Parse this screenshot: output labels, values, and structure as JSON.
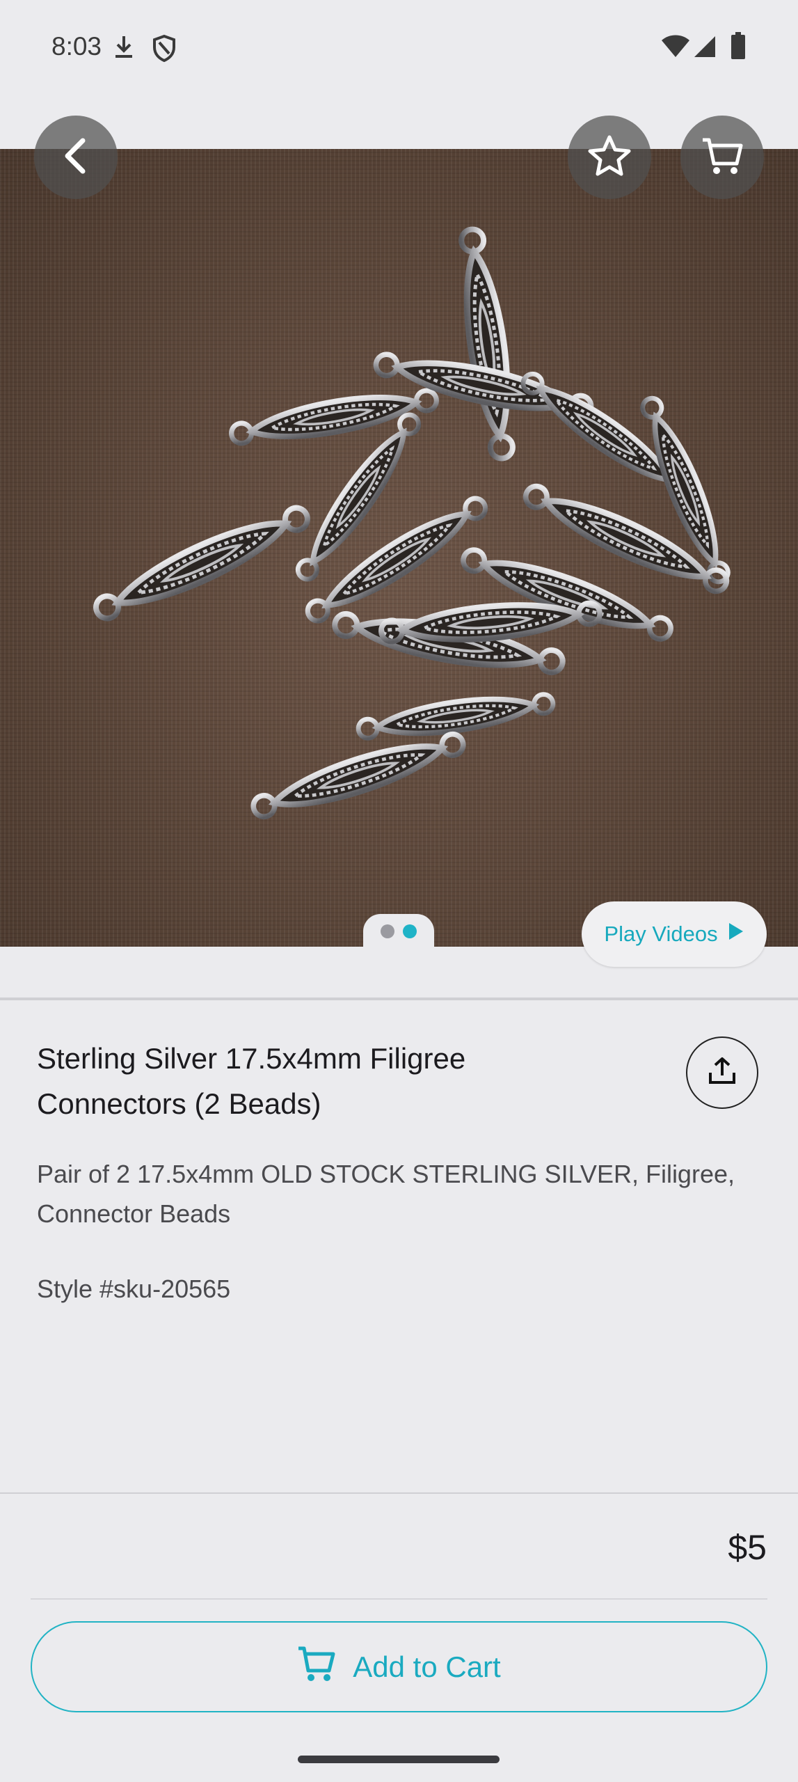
{
  "status_bar": {
    "time": "8:03",
    "icons": [
      "download-icon",
      "shield-icon",
      "wifi-icon",
      "signal-icon",
      "battery-icon"
    ]
  },
  "top_actions": {
    "back_icon": "chevron-left-icon",
    "favorite_icon": "star-icon",
    "cart_icon": "cart-icon"
  },
  "gallery": {
    "image_count": 2,
    "active_index": 1,
    "play_videos_label": "Play Videos"
  },
  "product": {
    "title": "Sterling Silver 17.5x4mm Filigree Connectors (2 Beads)",
    "description": "Pair of 2 17.5x4mm OLD STOCK STERLING SILVER, Filigree, Connector Beads",
    "style": "Style #sku-20565",
    "price": "$5"
  },
  "actions": {
    "add_to_cart_label": "Add to Cart",
    "share_icon": "share-icon"
  },
  "colors": {
    "accent": "#1fb3c7",
    "background": "#ebebee"
  }
}
